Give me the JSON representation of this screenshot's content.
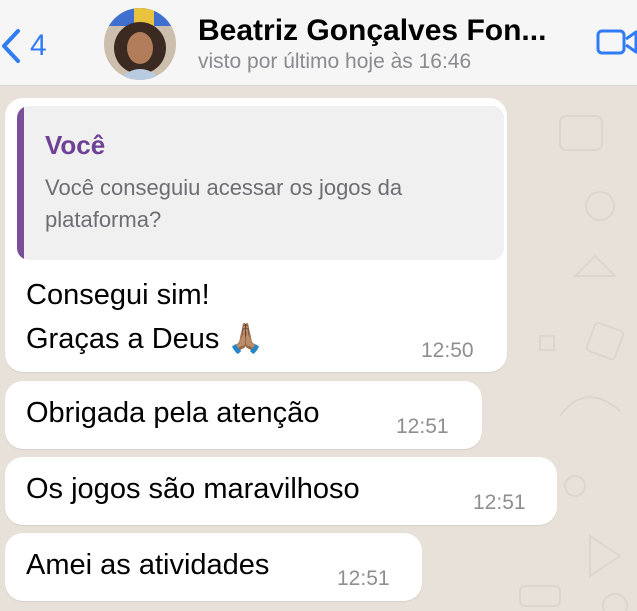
{
  "header": {
    "back_count": "4",
    "contact_name": "Beatriz Gonçalves  Fon...",
    "status": "visto por último hoje às 16:46"
  },
  "messages": [
    {
      "quote_author": "Você",
      "quote_text": "Você conseguiu acessar os jogos da plataforma?",
      "line1": "Consegui sim!",
      "line2": "Graças a Deus",
      "emoji": "🙏🏽",
      "time": "12:50"
    },
    {
      "text": "Obrigada pela atenção",
      "time": "12:51"
    },
    {
      "text": "Os jogos são maravilhoso",
      "time": "12:51"
    },
    {
      "text": "Amei as atividades",
      "time": "12:51"
    }
  ],
  "colors": {
    "accent": "#2f7cf6",
    "quote_author": "#6f4196",
    "quote_bar": "#7a4e99",
    "bubble": "#ffffff",
    "wallpaper": "#e7e1d9"
  },
  "icons": [
    "chevron-left-icon",
    "video-camera-icon",
    "praying-hands-emoji"
  ]
}
